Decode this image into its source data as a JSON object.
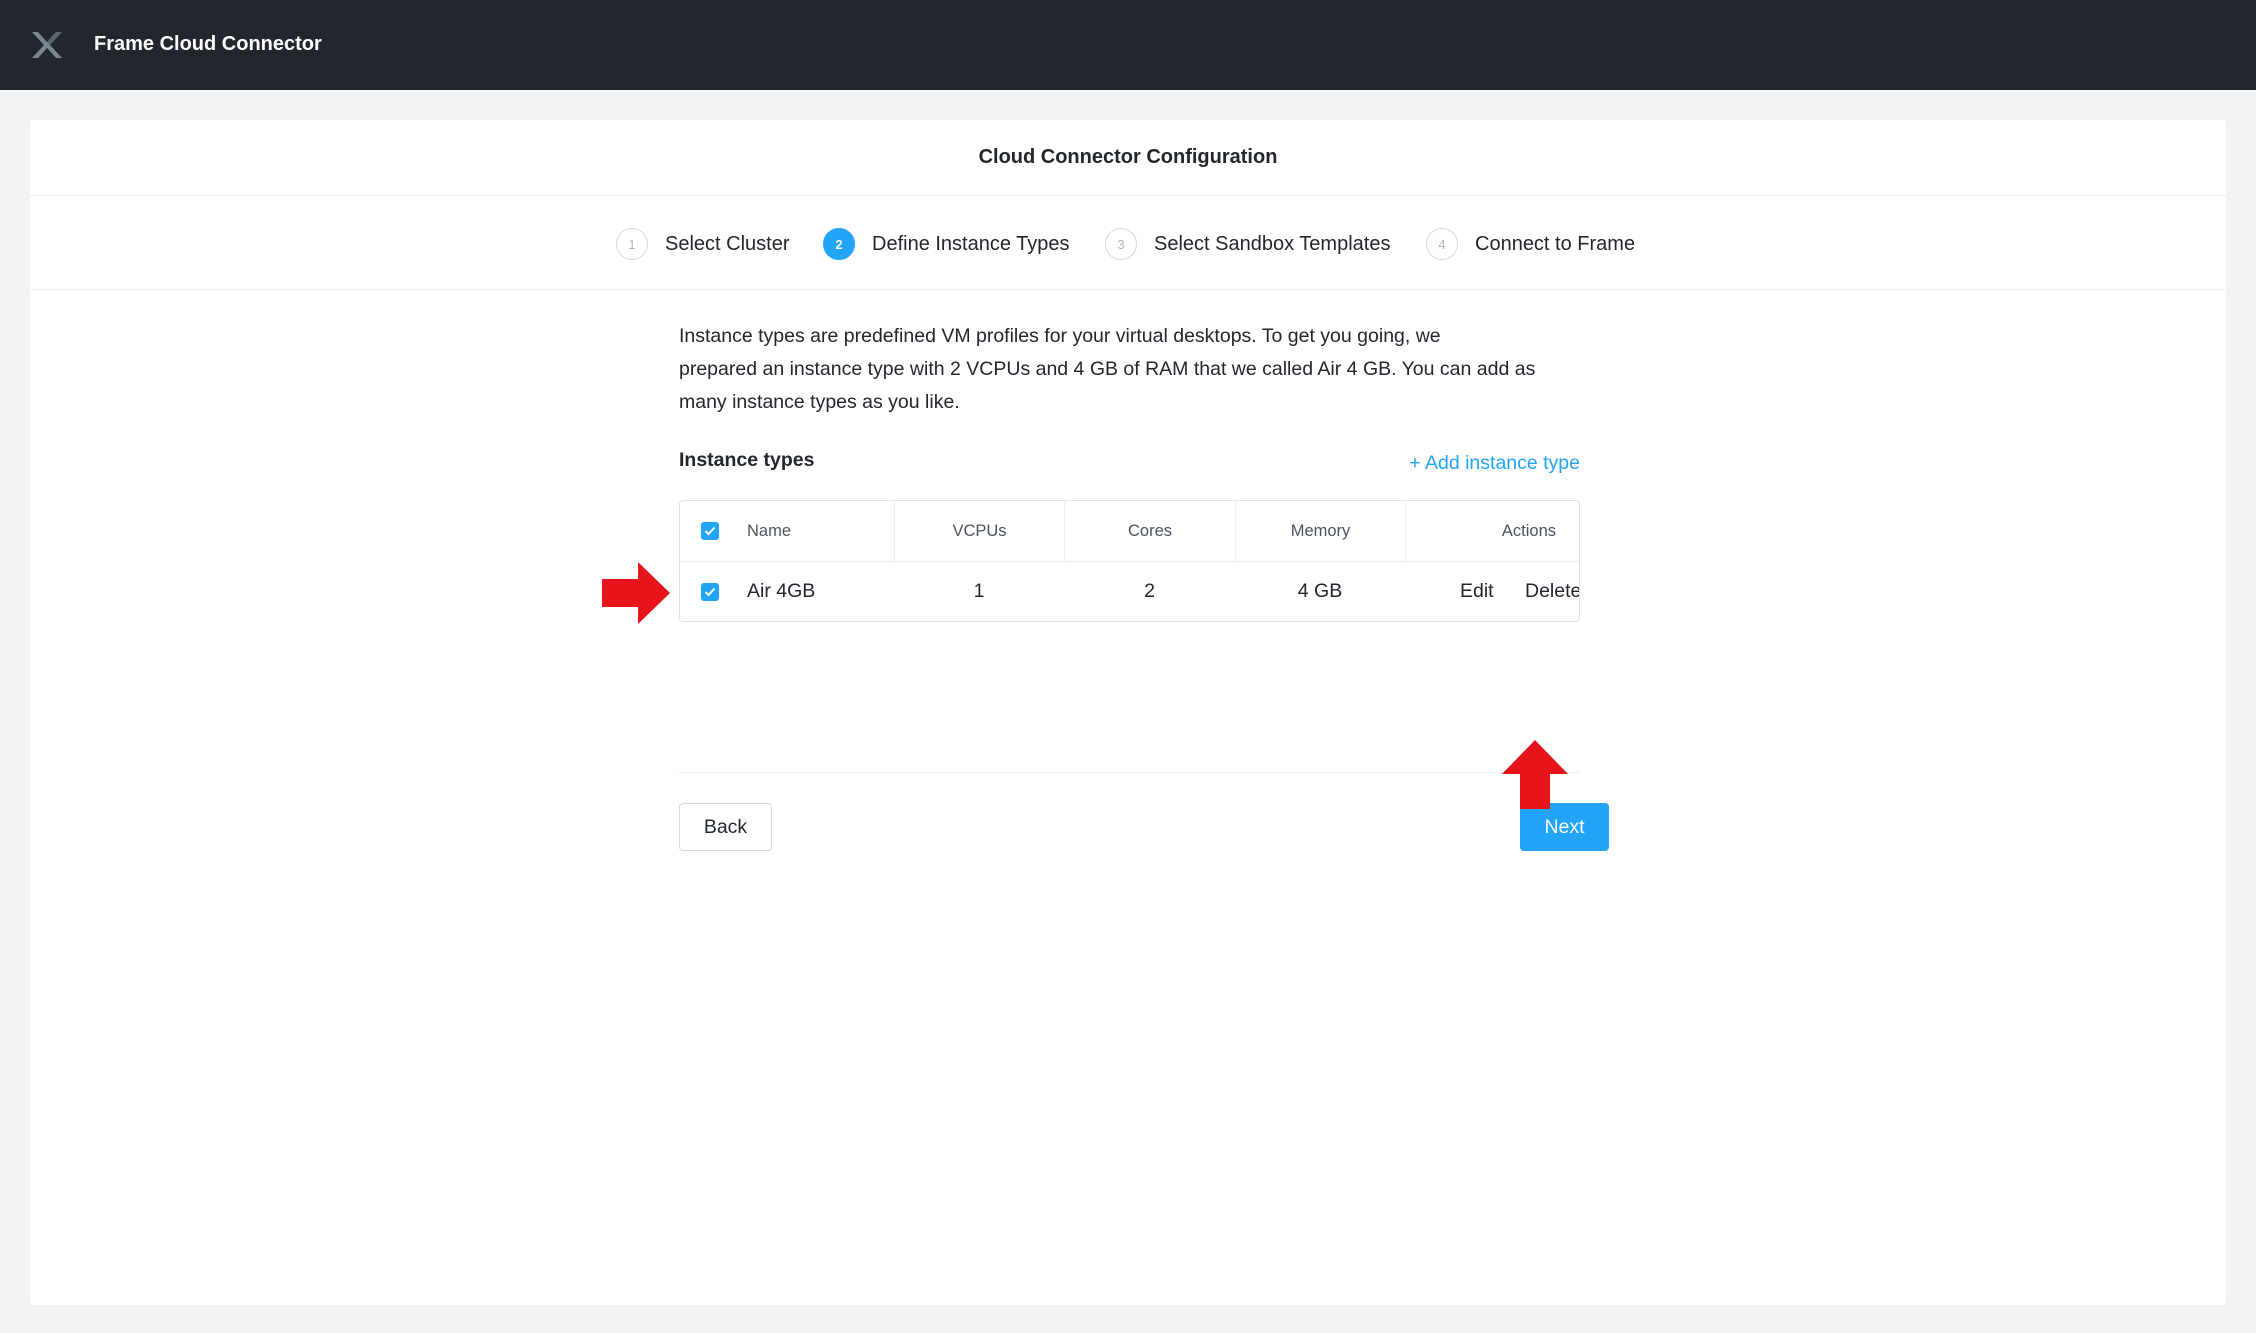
{
  "app": {
    "title": "Frame Cloud Connector",
    "logo_icon": "nutanix-x-logo"
  },
  "card": {
    "title": "Cloud Connector Configuration"
  },
  "steps": [
    {
      "number": "1",
      "label": "Select Cluster",
      "state": "inactive"
    },
    {
      "number": "2",
      "label": "Define Instance Types",
      "state": "active"
    },
    {
      "number": "3",
      "label": "Select Sandbox Templates",
      "state": "inactive"
    },
    {
      "number": "4",
      "label": "Connect to Frame",
      "state": "inactive"
    }
  ],
  "intro": {
    "line1": "Instance types are predefined VM profiles for your virtual desktops. To get you going, we",
    "line2": "prepared an instance type with 2 VCPUs and 4 GB of RAM that we called Air 4 GB. You can add as",
    "line3": "many instance types as you like."
  },
  "instance_types": {
    "title": "Instance types",
    "add_label": "+ Add instance type",
    "select_all_checked": true,
    "columns": {
      "name": "Name",
      "vcpus": "VCPUs",
      "cores": "Cores",
      "memory": "Memory",
      "actions": "Actions"
    },
    "rows": [
      {
        "checked": true,
        "name": "Air 4GB",
        "vcpus": "1",
        "cores": "2",
        "memory": "4 GB",
        "edit": "Edit",
        "delete": "Delete"
      }
    ]
  },
  "footer": {
    "back_label": "Back",
    "next_label": "Next"
  },
  "colors": {
    "topbar": "#22272e",
    "accent": "#22a5f7",
    "annotation": "#e8141c"
  }
}
